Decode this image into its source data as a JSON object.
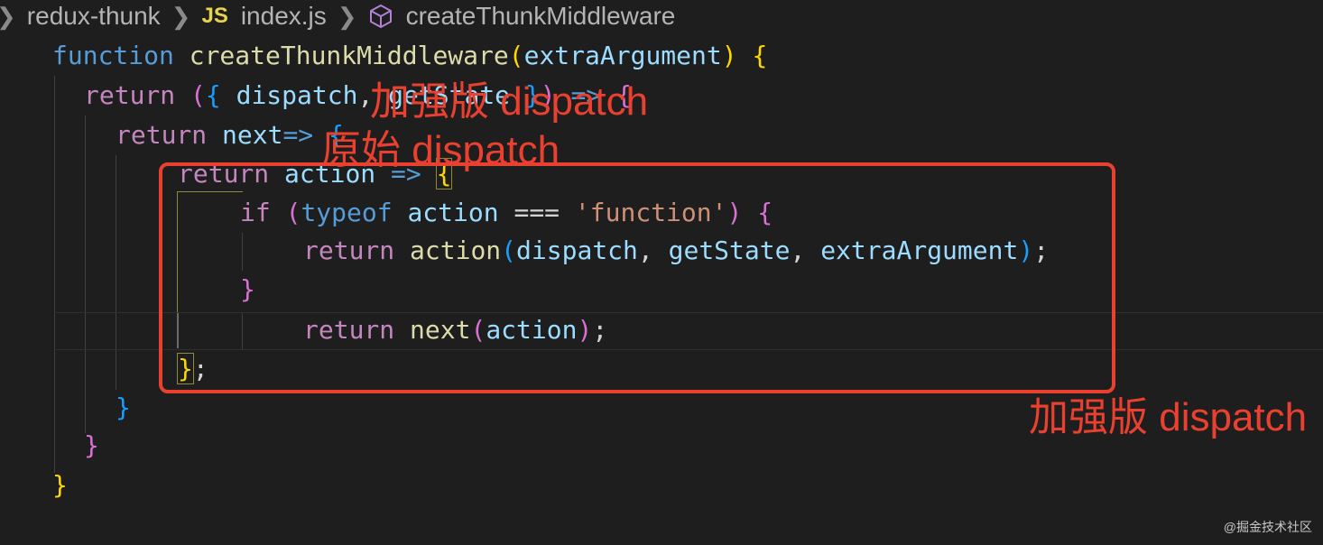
{
  "breadcrumb": {
    "folder": "redux-thunk",
    "file_icon": "JS",
    "file": "index.js",
    "symbol": "createThunkMiddleware"
  },
  "code": {
    "l1": {
      "kw": "function",
      "name": "createThunkMiddleware",
      "open": "(",
      "param": "extraArgument",
      "close": ")",
      "brace": "{"
    },
    "l2": {
      "kw": "return",
      "t1": "(",
      "t2": "{",
      "t3": "dispatch",
      "t4": ",",
      "t5": "getState",
      "t6": "}",
      "t7": ")",
      "arrow": "=>",
      "brace": "{"
    },
    "l3": {
      "kw": "return",
      "param": "next",
      "arrow": "=>",
      "brace": "{"
    },
    "l4": {
      "kw": "return",
      "param": "action",
      "arrow": "=>",
      "brace": "{"
    },
    "l5": {
      "kw": "if",
      "open": "(",
      "typeof": "typeof",
      "var": "action",
      "op": "===",
      "str": "'function'",
      "close": ")",
      "brace": "{"
    },
    "l6": {
      "kw": "return",
      "fn": "action",
      "open": "(",
      "a1": "dispatch",
      "c1": ",",
      "a2": "getState",
      "c2": ",",
      "a3": "extraArgument",
      "close": ")",
      "semi": ";"
    },
    "l7": {
      "brace": "}"
    },
    "l8": {
      "kw": "return",
      "fn": "next",
      "open": "(",
      "arg": "action",
      "close": ")",
      "semi": ";"
    },
    "l9": {
      "brace": "}",
      "semi": ";"
    },
    "l10": {
      "brace": "}"
    },
    "l11": {
      "brace": "}"
    },
    "l12": {
      "brace": "}"
    }
  },
  "annotations": {
    "top": "加强版 dispatch",
    "middle": "原始 dispatch",
    "bottom": "加强版 dispatch"
  },
  "watermark": "@掘金技术社区",
  "colors": {
    "annotation": "#e9402f",
    "background": "#1e1e1e"
  }
}
